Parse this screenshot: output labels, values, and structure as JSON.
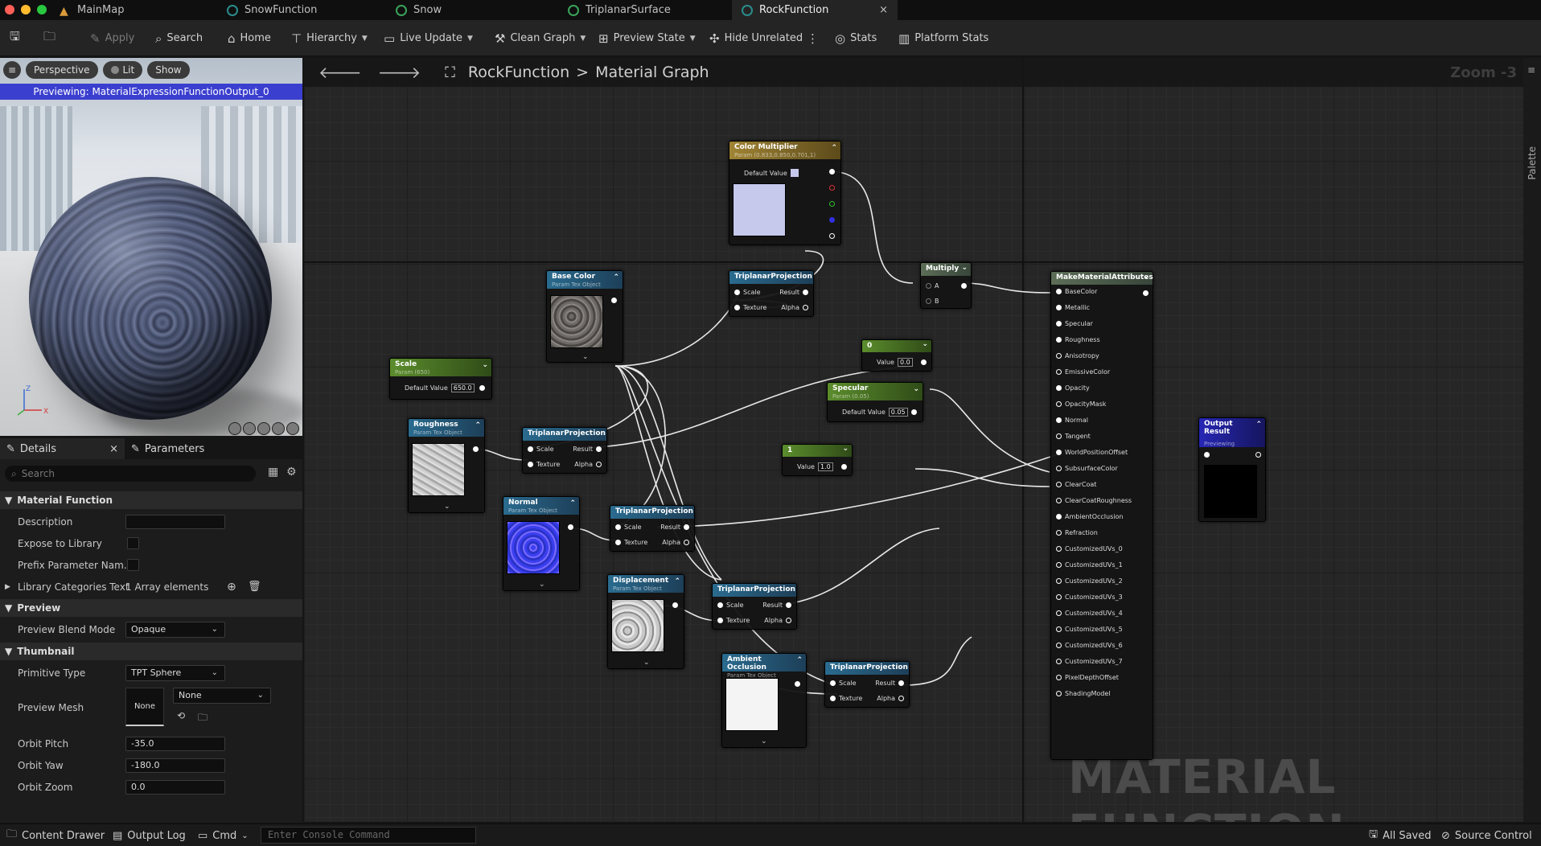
{
  "colors": {
    "accent_active_tab": "#242424",
    "preview_bar": "#3b3fcf",
    "close": "#ff5f57",
    "minimize": "#febc2e",
    "maximize": "#28c840"
  },
  "tabs": [
    {
      "label": "MainMap",
      "icon": "level-icon"
    },
    {
      "label": "SnowFunction",
      "icon": "material-function-icon"
    },
    {
      "label": "Snow",
      "icon": "material-icon"
    },
    {
      "label": "TriplanarSurface",
      "icon": "material-icon"
    },
    {
      "label": "RockFunction",
      "icon": "material-function-icon",
      "close": "×"
    }
  ],
  "toolbar": {
    "apply": "Apply",
    "search": "Search",
    "home": "Home",
    "hierarchy": "Hierarchy",
    "live_update": "Live Update",
    "clean_graph": "Clean Graph",
    "preview_state": "Preview State",
    "hide_unrelated": "Hide Unrelated",
    "stats": "Stats",
    "platform_stats": "Platform Stats"
  },
  "viewport": {
    "perspective": "Perspective",
    "lit": "Lit",
    "show": "Show",
    "previewing": "Previewing: MaterialExpressionFunctionOutput_0",
    "gizmo_z": "Z",
    "gizmo_x": "X"
  },
  "details": {
    "tab_details": "Details",
    "tab_close": "×",
    "tab_parameters": "Parameters",
    "search_placeholder": "Search",
    "sec_material_function": "Material Function",
    "description": "Description",
    "expose_to_library": "Expose to Library",
    "prefix_parameter": "Prefix Parameter Nam...",
    "library_categories": "Library Categories Text",
    "library_categories_value": "1 Array elements",
    "sec_preview": "Preview",
    "preview_blend_mode": "Preview Blend Mode",
    "preview_blend_mode_value": "Opaque",
    "sec_thumbnail": "Thumbnail",
    "primitive_type": "Primitive Type",
    "primitive_type_value": "TPT Sphere",
    "preview_mesh": "Preview Mesh",
    "preview_mesh_thumb": "None",
    "preview_mesh_value": "None",
    "orbit_pitch": "Orbit Pitch",
    "orbit_pitch_value": "-35.0",
    "orbit_yaw": "Orbit Yaw",
    "orbit_yaw_value": "-180.0",
    "orbit_zoom": "Orbit Zoom",
    "orbit_zoom_value": "0.0"
  },
  "graph": {
    "crumb_asset": "RockFunction",
    "crumb_sep": ">",
    "crumb_graph": "Material Graph",
    "zoom": "Zoom -3",
    "palette": "Palette",
    "watermark": "MATERIAL FUNCTION"
  },
  "nodes": {
    "color_multiplier": {
      "title": "Color Multiplier",
      "sub": "Param (0.833,0.850,0.701,1)",
      "default_value": "Default Value",
      "swatch": "#c6c8ec"
    },
    "base_color": {
      "title": "Base Color",
      "sub": "Param Tex Object"
    },
    "scale": {
      "title": "Scale",
      "sub": "Param (650)",
      "default_value": "Default Value",
      "value": "650.0"
    },
    "roughness": {
      "title": "Roughness",
      "sub": "Param Tex Object"
    },
    "normal": {
      "title": "Normal",
      "sub": "Param Tex Object"
    },
    "displacement": {
      "title": "Displacement",
      "sub": "Param Tex Object"
    },
    "ambient_occlusion": {
      "title": "Ambient Occlusion",
      "sub": "Param Tex Object"
    },
    "triplanar": {
      "title": "TriplanarProjection",
      "scale": "Scale",
      "texture": "Texture",
      "result": "Result",
      "alpha": "Alpha"
    },
    "multiply": {
      "title": "Multiply",
      "a": "A",
      "b": "B"
    },
    "const0": {
      "title": "0",
      "value_label": "Value",
      "value": "0.0"
    },
    "specular": {
      "title": "Specular",
      "sub": "Param (0.05)",
      "default_value": "Default Value",
      "value": "0.05"
    },
    "const1": {
      "title": "1",
      "value_label": "Value",
      "value": "1.0"
    },
    "make_attrs": {
      "title": "MakeMaterialAttributes",
      "pins": [
        "BaseColor",
        "Metallic",
        "Specular",
        "Roughness",
        "Anisotropy",
        "EmissiveColor",
        "Opacity",
        "OpacityMask",
        "Normal",
        "Tangent",
        "WorldPositionOffset",
        "SubsurfaceColor",
        "ClearCoat",
        "ClearCoatRoughness",
        "AmbientOcclusion",
        "Refraction",
        "CustomizedUVs_0",
        "CustomizedUVs_1",
        "CustomizedUVs_2",
        "CustomizedUVs_3",
        "CustomizedUVs_4",
        "CustomizedUVs_5",
        "CustomizedUVs_6",
        "CustomizedUVs_7",
        "PixelDepthOffset",
        "ShadingModel"
      ],
      "connected": [
        true,
        true,
        true,
        true,
        false,
        false,
        true,
        false,
        true,
        false,
        true,
        false,
        false,
        false,
        true,
        false,
        false,
        false,
        false,
        false,
        false,
        false,
        false,
        false,
        false,
        false
      ]
    },
    "output": {
      "title": "Output Result",
      "sub": "Previewing"
    }
  },
  "statusbar": {
    "content_drawer": "Content Drawer",
    "output_log": "Output Log",
    "cmd": "Cmd",
    "console_placeholder": "Enter Console Command",
    "all_saved": "All Saved",
    "source_control": "Source Control"
  }
}
